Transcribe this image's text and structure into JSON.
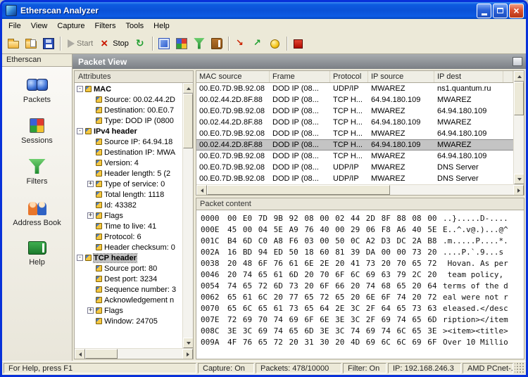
{
  "window": {
    "title": "Etherscan Analyzer",
    "controls": [
      "minimize",
      "maximize",
      "close"
    ]
  },
  "menu": {
    "items": [
      "File",
      "View",
      "Capture",
      "Filters",
      "Tools",
      "Help"
    ]
  },
  "toolbar": {
    "buttons": [
      {
        "name": "open",
        "icon": "folder-open-icon"
      },
      {
        "name": "open-capture",
        "icon": "folder-file-icon"
      },
      {
        "name": "save",
        "icon": "save-icon"
      },
      {
        "separator": true
      },
      {
        "name": "start",
        "icon": "play-icon",
        "label": "Start",
        "disabled": true
      },
      {
        "name": "stop",
        "icon": "stop-x-icon",
        "label": "Stop"
      },
      {
        "name": "refresh",
        "icon": "refresh-icon"
      },
      {
        "separator": true
      },
      {
        "name": "packet-view",
        "icon": "packet-view-icon"
      },
      {
        "name": "session-view",
        "icon": "session-view-icon"
      },
      {
        "name": "filter-view",
        "icon": "filter-funnel-icon"
      },
      {
        "name": "address-book",
        "icon": "address-book-icon"
      },
      {
        "separator": true
      },
      {
        "name": "send-traffic",
        "icon": "red-arrow-icon"
      },
      {
        "name": "receive-traffic",
        "icon": "green-arrow-icon"
      },
      {
        "name": "alerts",
        "icon": "yellow-ball-icon"
      },
      {
        "separator": true
      },
      {
        "name": "record",
        "icon": "red-square-icon"
      }
    ]
  },
  "sidebar": {
    "header": "Etherscan",
    "items": [
      {
        "label": "Packets",
        "icon": "packets-icon"
      },
      {
        "label": "Sessions",
        "icon": "sessions-icon"
      },
      {
        "label": "Filters",
        "icon": "filters-icon"
      },
      {
        "label": "Address Book",
        "icon": "addressbook-icon"
      },
      {
        "label": "Help",
        "icon": "help-icon"
      }
    ]
  },
  "main": {
    "title": "Packet View",
    "attributes": {
      "header": "Attributes",
      "items": [
        {
          "label": "MAC",
          "depth": 0,
          "expander": "minus",
          "bold": true
        },
        {
          "label": "Source: 00.02.44.2D",
          "depth": 1
        },
        {
          "label": "Destination: 00.E0.7",
          "depth": 1
        },
        {
          "label": "Type: DOD IP (0800",
          "depth": 1
        },
        {
          "label": "IPv4 header",
          "depth": 0,
          "expander": "minus",
          "bold": true
        },
        {
          "label": "Source IP: 64.94.18",
          "depth": 1
        },
        {
          "label": "Destination IP: MWA",
          "depth": 1
        },
        {
          "label": "Version: 4",
          "depth": 1
        },
        {
          "label": "Header length: 5 (2",
          "depth": 1
        },
        {
          "label": "Type of service: 0",
          "depth": 1,
          "expander": "plus"
        },
        {
          "label": "Total length: 1118",
          "depth": 1
        },
        {
          "label": "Id: 43382",
          "depth": 1
        },
        {
          "label": "Flags",
          "depth": 1,
          "expander": "plus"
        },
        {
          "label": "Time to live: 41",
          "depth": 1
        },
        {
          "label": "Protocol: 6",
          "depth": 1
        },
        {
          "label": "Header checksum: 0",
          "depth": 1
        },
        {
          "label": "TCP header",
          "depth": 0,
          "expander": "minus",
          "bold": true,
          "selected": true
        },
        {
          "label": "Source port: 80",
          "depth": 1
        },
        {
          "label": "Dest port: 3234",
          "depth": 1
        },
        {
          "label": "Sequence number: 3",
          "depth": 1
        },
        {
          "label": "Acknowledgement n",
          "depth": 1
        },
        {
          "label": "Flags",
          "depth": 1,
          "expander": "plus"
        },
        {
          "label": "Window: 24705",
          "depth": 1
        }
      ]
    },
    "packet_list": {
      "columns": [
        "MAC source",
        "Frame",
        "Protocol",
        "IP source",
        "IP dest"
      ],
      "selected_row": 5,
      "rows": [
        [
          "00.E0.7D.9B.92.08",
          "DOD IP (08...",
          "UDP/IP",
          "MWAREZ",
          "ns1.quantum.ru"
        ],
        [
          "00.02.44.2D.8F.88",
          "DOD IP (08...",
          "TCP H...",
          "64.94.180.109",
          "MWAREZ"
        ],
        [
          "00.E0.7D.9B.92.08",
          "DOD IP (08...",
          "TCP H...",
          "MWAREZ",
          "64.94.180.109"
        ],
        [
          "00.02.44.2D.8F.88",
          "DOD IP (08...",
          "TCP H...",
          "64.94.180.109",
          "MWAREZ"
        ],
        [
          "00.E0.7D.9B.92.08",
          "DOD IP (08...",
          "TCP H...",
          "MWAREZ",
          "64.94.180.109"
        ],
        [
          "00.02.44.2D.8F.88",
          "DOD IP (08...",
          "TCP H...",
          "64.94.180.109",
          "MWAREZ"
        ],
        [
          "00.E0.7D.9B.92.08",
          "DOD IP (08...",
          "TCP H...",
          "MWAREZ",
          "64.94.180.109"
        ],
        [
          "00.E0.7D.9B.92.08",
          "DOD IP (08...",
          "UDP/IP",
          "MWAREZ",
          "DNS Server"
        ],
        [
          "00.E0.7D.9B.92.08",
          "DOD IP (08...",
          "UDP/IP",
          "MWAREZ",
          "DNS Server"
        ]
      ]
    },
    "packet_content": {
      "header": "Packet content",
      "lines": [
        {
          "offset": "0000",
          "hex": "00 E0 7D 9B 92 08 00 02 44 2D 8F 88 08 00",
          "ascii": "..}.....D-...."
        },
        {
          "offset": "000E",
          "hex": "45 00 04 5E A9 76 40 00 29 06 F8 A6 40 5E",
          "ascii": "E..^.v@.)...@^"
        },
        {
          "offset": "001C",
          "hex": "B4 6D C0 A8 F6 03 00 50 0C A2 D3 DC 2A B8",
          "ascii": ".m.....P....*."
        },
        {
          "offset": "002A",
          "hex": "16 BD 94 ED 50 18 60 81 39 DA 00 00 73 20",
          "ascii": "....P.`.9...s "
        },
        {
          "offset": "0038",
          "hex": "20 48 6F 76 61 6E 2E 20 41 73 20 70 65 72",
          "ascii": " Hovan. As per"
        },
        {
          "offset": "0046",
          "hex": "20 74 65 61 6D 20 70 6F 6C 69 63 79 2C 20",
          "ascii": " team policy, "
        },
        {
          "offset": "0054",
          "hex": "74 65 72 6D 73 20 6F 66 20 74 68 65 20 64",
          "ascii": "terms of the d"
        },
        {
          "offset": "0062",
          "hex": "65 61 6C 20 77 65 72 65 20 6E 6F 74 20 72",
          "ascii": "eal were not r"
        },
        {
          "offset": "0070",
          "hex": "65 6C 65 61 73 65 64 2E 3C 2F 64 65 73 63",
          "ascii": "eleased.</desc"
        },
        {
          "offset": "007E",
          "hex": "72 69 70 74 69 6F 6E 3E 3C 2F 69 74 65 6D",
          "ascii": "ription></item"
        },
        {
          "offset": "008C",
          "hex": "3E 3C 69 74 65 6D 3E 3C 74 69 74 6C 65 3E",
          "ascii": "><item><title>"
        },
        {
          "offset": "009A",
          "hex": "4F 76 65 72 20 31 30 20 4D 69 6C 6C 69 6F",
          "ascii": "Over 10 Millio"
        }
      ]
    }
  },
  "status": {
    "help": "For Help, press F1",
    "panels": [
      "Capture: On",
      "Packets: 478/10000",
      "Filter: On",
      "IP: 192.168.246.3",
      "AMD PCnet-..."
    ]
  },
  "colors": {
    "titlebar_blue": "#0A53DE",
    "selection_gray": "#C4C4C4",
    "stop_red": "#C91800",
    "view_header_gray": "#7A7F84"
  }
}
